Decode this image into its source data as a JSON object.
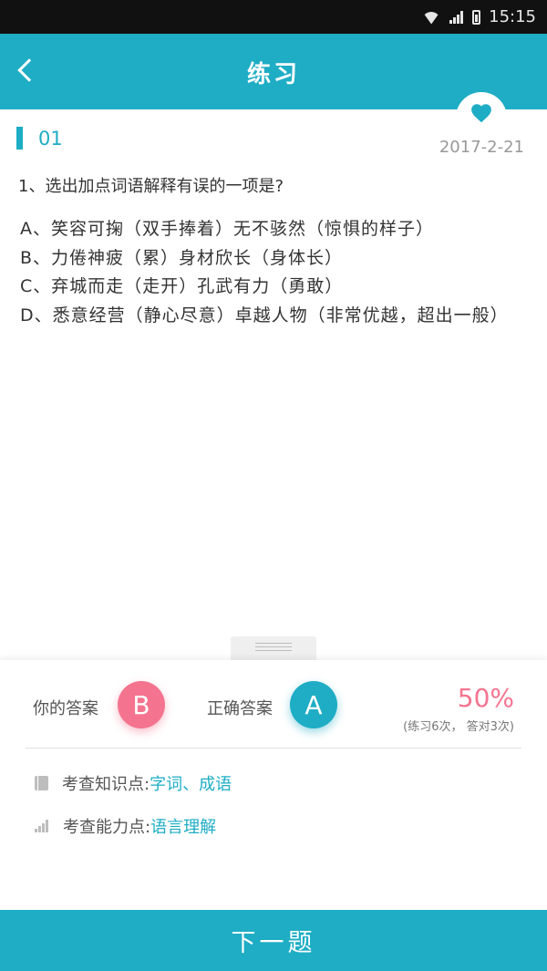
{
  "status_bar": {
    "time": "15:15"
  },
  "header": {
    "title": "练习",
    "back_icon": "chevron-left-icon"
  },
  "favorite": {
    "icon": "heart-icon",
    "color": "#1eadc5"
  },
  "question": {
    "index": "01",
    "date": "2017-2-21",
    "text": "1、选出加点词语解释有误的一项是?",
    "options": [
      "A、笑容可掬（双手捧着）无不骇然（惊惧的样子）",
      "B、力倦神疲（累）身材欣长（身体长）",
      "C、弃城而走（走开）孔武有力（勇敢）",
      "D、悉意经营（静心尽意）卓越人物（非常优越，超出一般）"
    ]
  },
  "answers": {
    "your_label": "你的答案",
    "your_choice": "B",
    "correct_label": "正确答案",
    "correct_choice": "A",
    "accuracy": "50%",
    "stats": "(练习6次， 答对3次)"
  },
  "details": {
    "knowledge_label": "考查知识点:",
    "knowledge_value": "字词、成语",
    "ability_label": "考查能力点:",
    "ability_value": "语言理解"
  },
  "footer": {
    "next_label": "下一题"
  },
  "colors": {
    "accent": "#1eadc5",
    "wrong": "#f4748f"
  }
}
